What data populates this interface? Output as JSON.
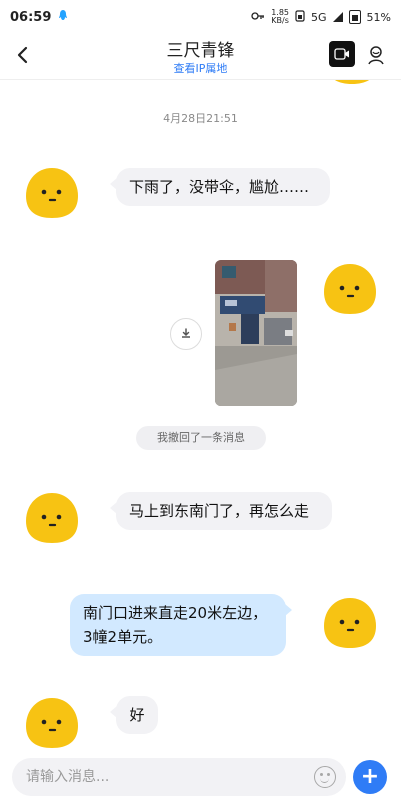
{
  "status_bar": {
    "time": "06:59",
    "network_speed_value": "1.85",
    "network_speed_unit": "KB/s",
    "network_type": "5G",
    "battery_percent": "51%"
  },
  "header": {
    "title": "三尺青锋",
    "subtitle": "查看IP属地"
  },
  "chat": {
    "timestamp": "4月28日21:51",
    "messages": [
      {
        "text": "下雨了，没带伞，尴尬……"
      },
      {
        "text": "我撤回了一条消息"
      },
      {
        "text": "马上到东南门了，再怎么走"
      },
      {
        "text": "南门口进来直走20米左边，3幢2单元。"
      },
      {
        "text": "好"
      }
    ]
  },
  "footer": {
    "input_placeholder": "请输入消息..."
  },
  "colors": {
    "accent": "#2f7cf6",
    "incoming_bubble": "#f2f2f5",
    "outgoing_bubble": "#d2e9ff",
    "avatar_yellow": "#f7c313"
  }
}
